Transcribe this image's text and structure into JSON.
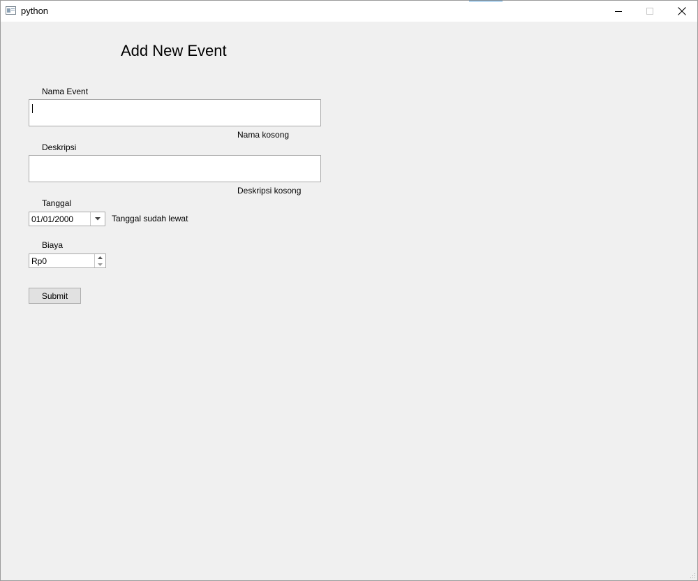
{
  "window": {
    "title": "python",
    "icon": "window-app-icon",
    "controls": [
      "minimize-icon",
      "maximize-icon",
      "close-icon"
    ]
  },
  "form": {
    "heading": "Add New Event",
    "nama_event": {
      "label": "Nama Event",
      "value": "",
      "error": "Nama kosong"
    },
    "deskripsi": {
      "label": "Deskripsi",
      "value": "",
      "error": "Deskripsi kosong"
    },
    "tanggal": {
      "label": "Tanggal",
      "value": "01/01/2000",
      "error": "Tanggal sudah lewat"
    },
    "biaya": {
      "label": "Biaya",
      "value": "Rp0"
    },
    "submit_label": "Submit"
  },
  "colors": {
    "background": "#f0f0f0",
    "titlebar": "#ffffff",
    "field_border": "#a9a9a9",
    "button_face": "#e1e1e1"
  }
}
